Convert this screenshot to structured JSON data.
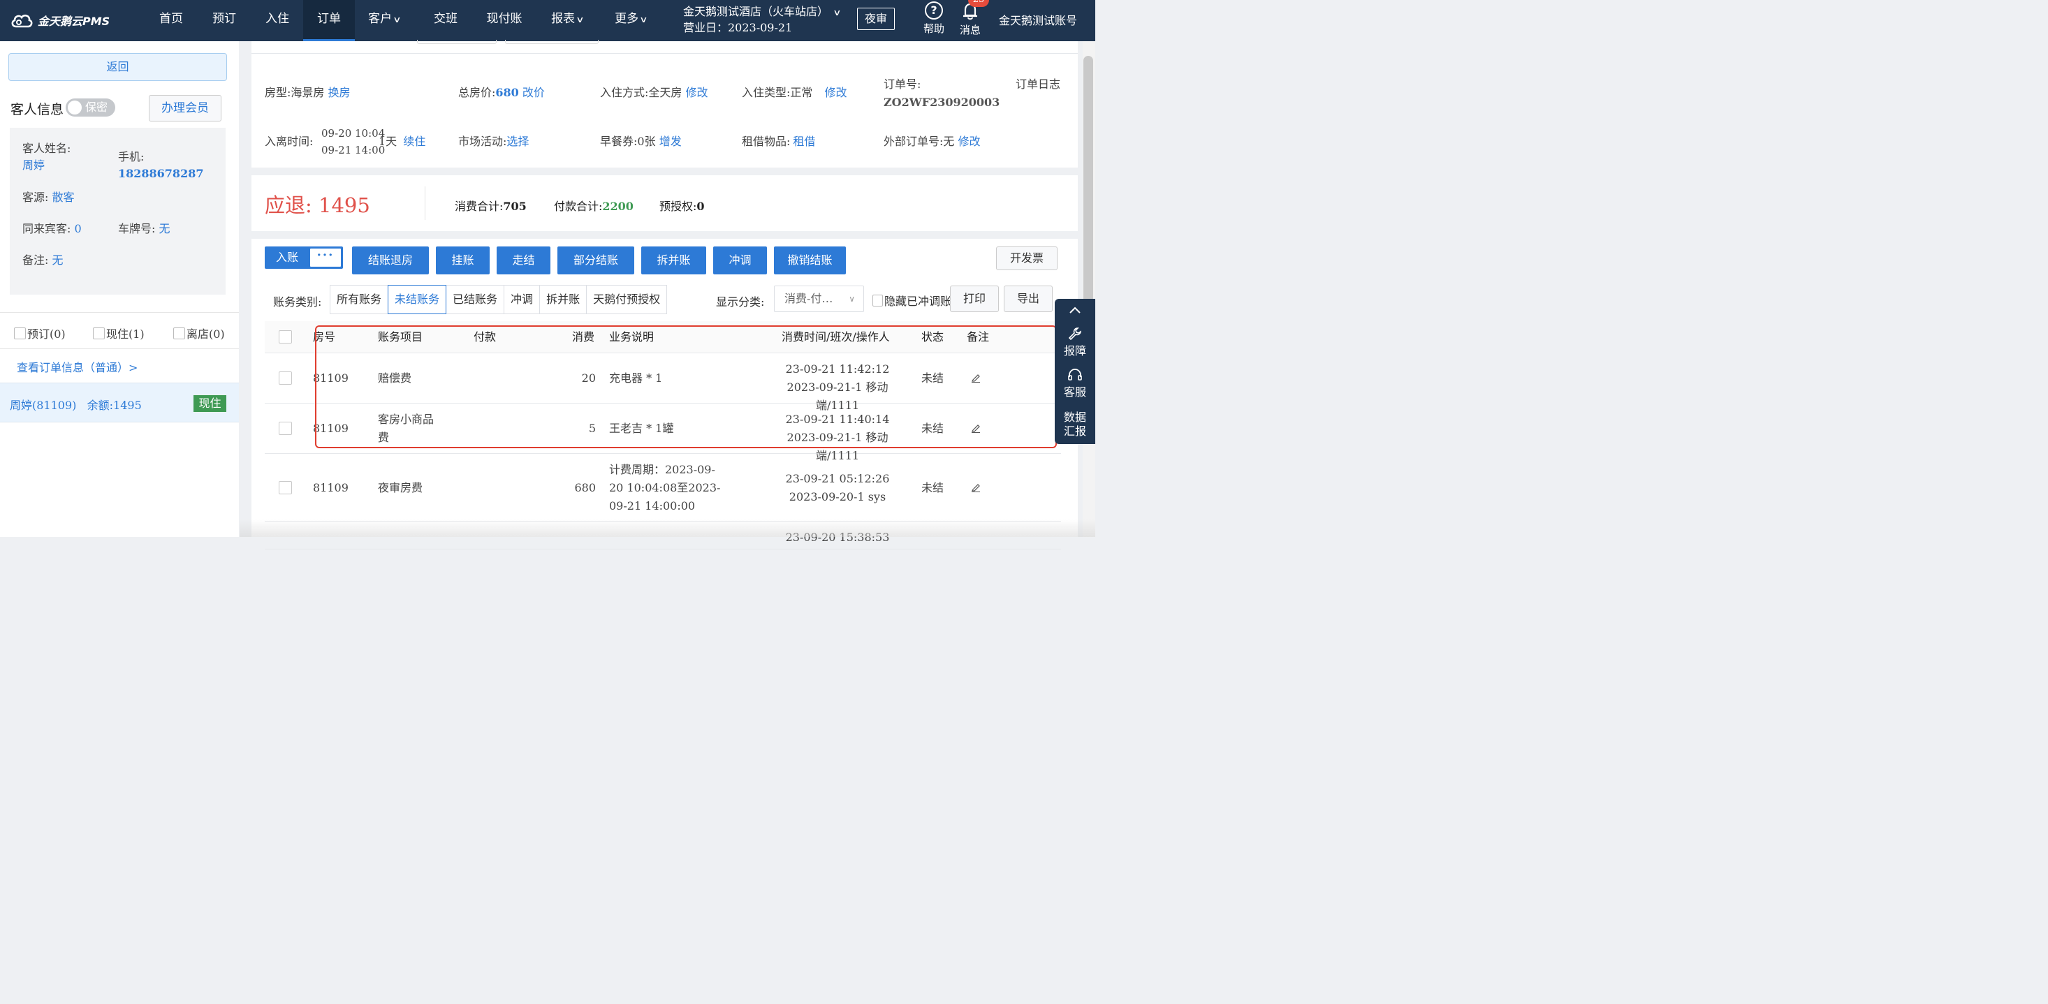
{
  "app": {
    "logo_text": "金天鹅云PMS",
    "nav": [
      {
        "label": "首页",
        "caret": false,
        "active": false
      },
      {
        "label": "预订",
        "caret": false,
        "active": false
      },
      {
        "label": "入住",
        "caret": false,
        "active": false
      },
      {
        "label": "订单",
        "caret": false,
        "active": true
      },
      {
        "label": "客户",
        "caret": true,
        "active": false
      },
      {
        "label": "交班",
        "caret": false,
        "active": false
      },
      {
        "label": "现付账",
        "caret": false,
        "active": false
      },
      {
        "label": "报表",
        "caret": true,
        "active": false
      },
      {
        "label": "更多",
        "caret": true,
        "active": false
      }
    ],
    "hotel_name": "金天鹅测试酒店（火车站店）",
    "business_day": "营业日：2023-09-21",
    "night_audit": "夜审",
    "help": "帮助",
    "messages": "消息",
    "message_count": "25",
    "account": "金天鹅测试账号"
  },
  "left": {
    "back": "返回",
    "guest_info_title": "客人信息",
    "privacy_toggle": "保密",
    "join_member": "办理会员",
    "guest": {
      "name_label": "客人姓名:",
      "name": "周婷",
      "phone_label": "手机:",
      "phone": "18288678287",
      "source_label": "客源:",
      "source": "散客",
      "companions_label": "同来宾客:",
      "companions": "0",
      "plate_label": "车牌号:",
      "plate": "无",
      "note_label": "备注:",
      "note": "无"
    },
    "filters": {
      "reserved": "预订(0)",
      "in_house": "现住(1)",
      "departed": "离店(0)"
    },
    "order_info_link": "查看订单信息（普通）>",
    "guest_row": {
      "text": "周婷(81109)   余额:1495",
      "badge": "现住"
    }
  },
  "order": {
    "room_type_label": "房型:",
    "room_type": "海景房",
    "change_room": "换房",
    "total_price_label": "总房价:",
    "total_price": "680",
    "edit_price": "改价",
    "stay_mode_label": "入住方式:",
    "stay_mode": "全天房",
    "stay_mode_edit": "修改",
    "checkin_type_label": "入住类型:",
    "checkin_type": "正常",
    "checkin_type_edit": "修改",
    "order_no_label": "订单号:",
    "order_no": "ZO2WF230920003",
    "order_log": "订单日志",
    "stay_time_label": "入离时间:",
    "arrive": "09-20 10:04",
    "depart": "09-21 14:00",
    "nights": "1天",
    "extend": "续住",
    "marketing_label": "市场活动:",
    "marketing": "选择",
    "breakfast_label": "早餐券:",
    "breakfast": "0张",
    "breakfast_add": "增发",
    "rental_label": "租借物品:",
    "rental": "租借",
    "external_label": "外部订单号:",
    "external": "无",
    "external_edit": "修改"
  },
  "summary": {
    "refund_label": "应退:",
    "refund": "1495",
    "consume_label": "消费合计:",
    "consume": "705",
    "payment_label": "付款合计:",
    "payment": "2200",
    "preauth_label": "预授权:",
    "preauth": "0"
  },
  "bill": {
    "post": "入账",
    "more": "···",
    "actions": [
      "结账退房",
      "挂账",
      "走结",
      "部分结账",
      "拆并账",
      "冲调",
      "撤销结账"
    ],
    "invoice": "开发票",
    "account_type_label": "账务类别:",
    "account_tabs": [
      "所有账务",
      "未结账务",
      "已结账务",
      "冲调",
      "拆并账",
      "天鹅付预授权"
    ],
    "active_tab": "未结账务",
    "display_label": "显示分类:",
    "display_value": "消费-付…",
    "hide_adjusted": "隐藏已冲调账",
    "print": "打印",
    "export": "导出",
    "columns": [
      "房号",
      "账务项目",
      "付款",
      "消费",
      "业务说明",
      "消费时间/班次/操作人",
      "状态",
      "备注"
    ],
    "rows": [
      {
        "room": "81109",
        "item": "赔偿费",
        "payment": "",
        "consume": "20",
        "desc": "充电器 * 1",
        "time1": "23-09-21 11:42:12",
        "time2": "2023-09-21-1 移动端/1111",
        "status": "未结"
      },
      {
        "room": "81109",
        "item": "客房小商品费",
        "payment": "",
        "consume": "5",
        "desc": "王老吉 * 1罐",
        "time1": "23-09-21 11:40:14",
        "time2": "2023-09-21-1 移动端/1111",
        "status": "未结"
      },
      {
        "room": "81109",
        "item": "夜审房费",
        "payment": "",
        "consume": "680",
        "desc": "计费周期：2023-09-20 10:04:08至2023-09-21 14:00:00",
        "time1": "23-09-21 05:12:26",
        "time2": "2023-09-20-1 sys",
        "status": "未结"
      },
      {
        "room": "",
        "item": "",
        "payment": "",
        "consume": "",
        "desc": "",
        "time1": "23-09-20 15:38:53",
        "time2": "",
        "status": ""
      }
    ]
  },
  "float": {
    "report_issue": "报障",
    "support": "客服",
    "data_report": "数据汇报"
  }
}
